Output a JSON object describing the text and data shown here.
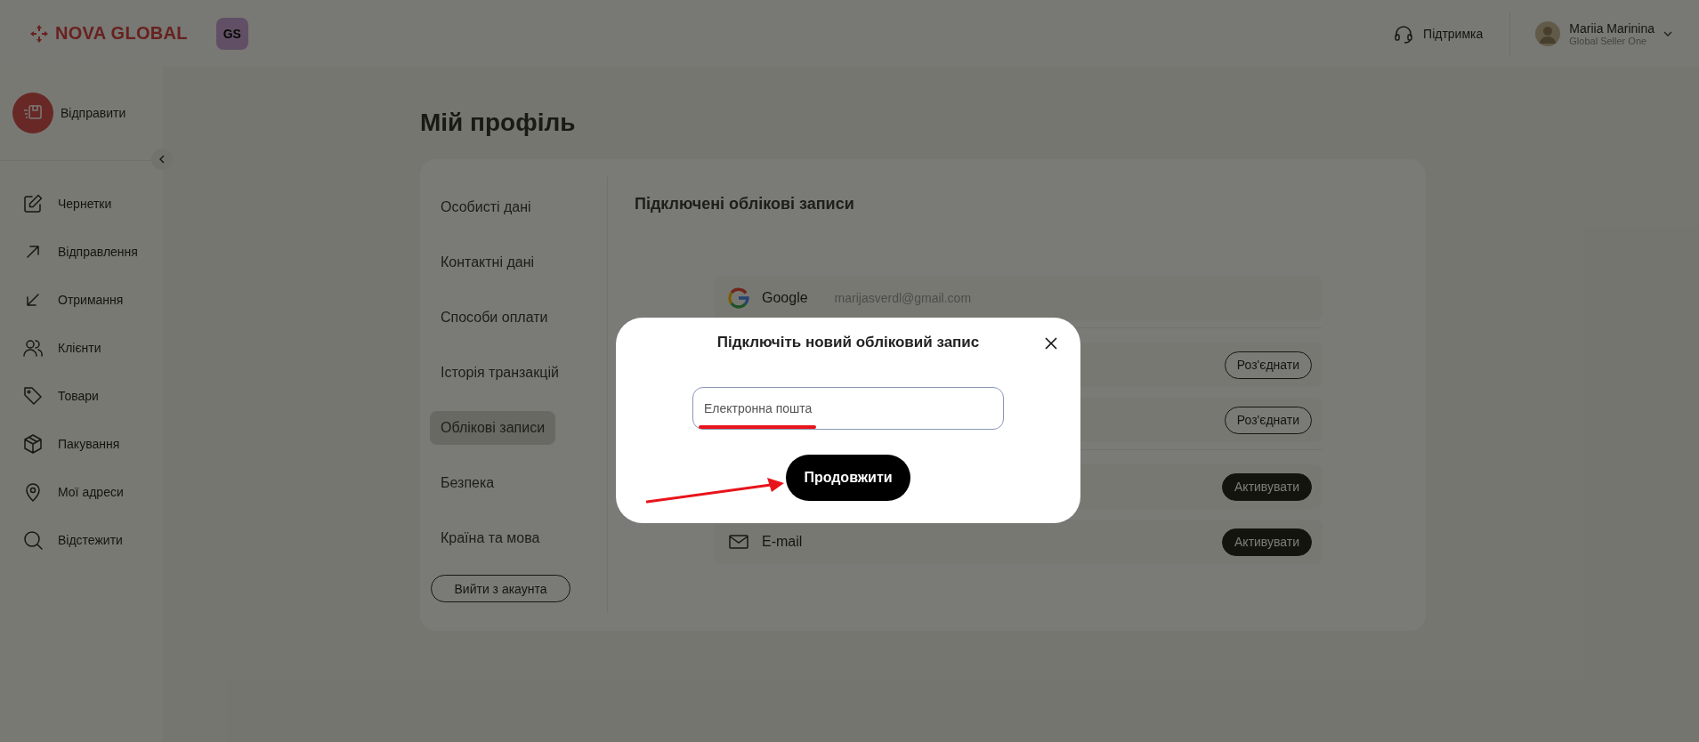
{
  "header": {
    "logo": "NOVA GLOBAL",
    "badge": "GS",
    "support": "Підтримка",
    "user": {
      "name": "Mariia Marinina",
      "role": "Global Seller One"
    }
  },
  "sidebar": {
    "primary_action": "Відправити",
    "items": [
      {
        "kind": "edit",
        "label": "Чернетки"
      },
      {
        "kind": "outgoing",
        "label": "Відправлення"
      },
      {
        "kind": "incoming",
        "label": "Отримання"
      },
      {
        "kind": "users",
        "label": "Клієнти"
      },
      {
        "kind": "tag",
        "label": "Товари"
      },
      {
        "kind": "box",
        "label": "Пакування"
      },
      {
        "kind": "pin",
        "label": "Мої адреси"
      },
      {
        "kind": "search",
        "label": "Відстежити"
      }
    ]
  },
  "page_title": "Мій профіль",
  "profile_menu": {
    "items": [
      {
        "label": "Особисті дані",
        "selected": false
      },
      {
        "label": "Контактні дані",
        "selected": false
      },
      {
        "label": "Способи оплати",
        "selected": false
      },
      {
        "label": "Історія транзакцій",
        "selected": false
      },
      {
        "label": "Облікові записи",
        "selected": true
      },
      {
        "label": "Безпека",
        "selected": false
      },
      {
        "label": "Країна та мова",
        "selected": false
      }
    ],
    "logout": "Вийти з акаунта"
  },
  "accounts": {
    "title": "Підключені облікові записи",
    "groups": [
      {
        "rows": [
          {
            "kind": "google",
            "label": "Google",
            "value": "marijasverdl@gmail.com"
          }
        ]
      },
      {
        "rows": [
          {
            "action": {
              "kind": "disconnect",
              "label": "Роз'єднати"
            }
          },
          {
            "action": {
              "kind": "disconnect",
              "label": "Роз'єднати"
            }
          }
        ]
      },
      {
        "rows": [
          {
            "action": {
              "kind": "activate",
              "label": "Активувати"
            }
          },
          {
            "kind": "email",
            "label": "E-mail",
            "action": {
              "kind": "activate",
              "label": "Активувати"
            }
          }
        ]
      }
    ]
  },
  "modal": {
    "title": "Підключіть новий обліковий запис",
    "field": {
      "placeholder": "Електронна пошта"
    },
    "button": "Продовжити"
  }
}
